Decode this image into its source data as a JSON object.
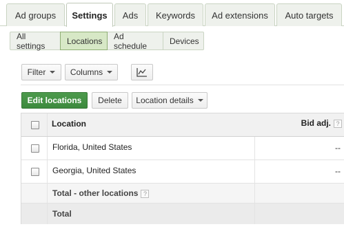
{
  "tabs": {
    "ad_groups": "Ad groups",
    "settings": "Settings",
    "ads": "Ads",
    "keywords": "Keywords",
    "ad_extensions": "Ad extensions",
    "auto_targets": "Auto targets"
  },
  "subtabs": {
    "all_settings": "All settings",
    "locations": "Locations",
    "ad_schedule": "Ad schedule",
    "devices": "Devices"
  },
  "toolbar": {
    "filter": "Filter",
    "columns": "Columns",
    "chart_icon": "line-chart-icon"
  },
  "actions": {
    "edit_locations": "Edit locations",
    "delete": "Delete",
    "location_details": "Location details"
  },
  "table": {
    "col_location": "Location",
    "col_bid_adj": "Bid adj.",
    "help_glyph": "?",
    "rows": [
      {
        "location": "Florida, United States",
        "bid": "--"
      },
      {
        "location": "Georgia, United States",
        "bid": "--"
      }
    ],
    "total_other": "Total - other locations",
    "total": "Total"
  },
  "colors": {
    "primary_green": "#3c8a3d",
    "active_subtab": "#d7e8c6"
  }
}
